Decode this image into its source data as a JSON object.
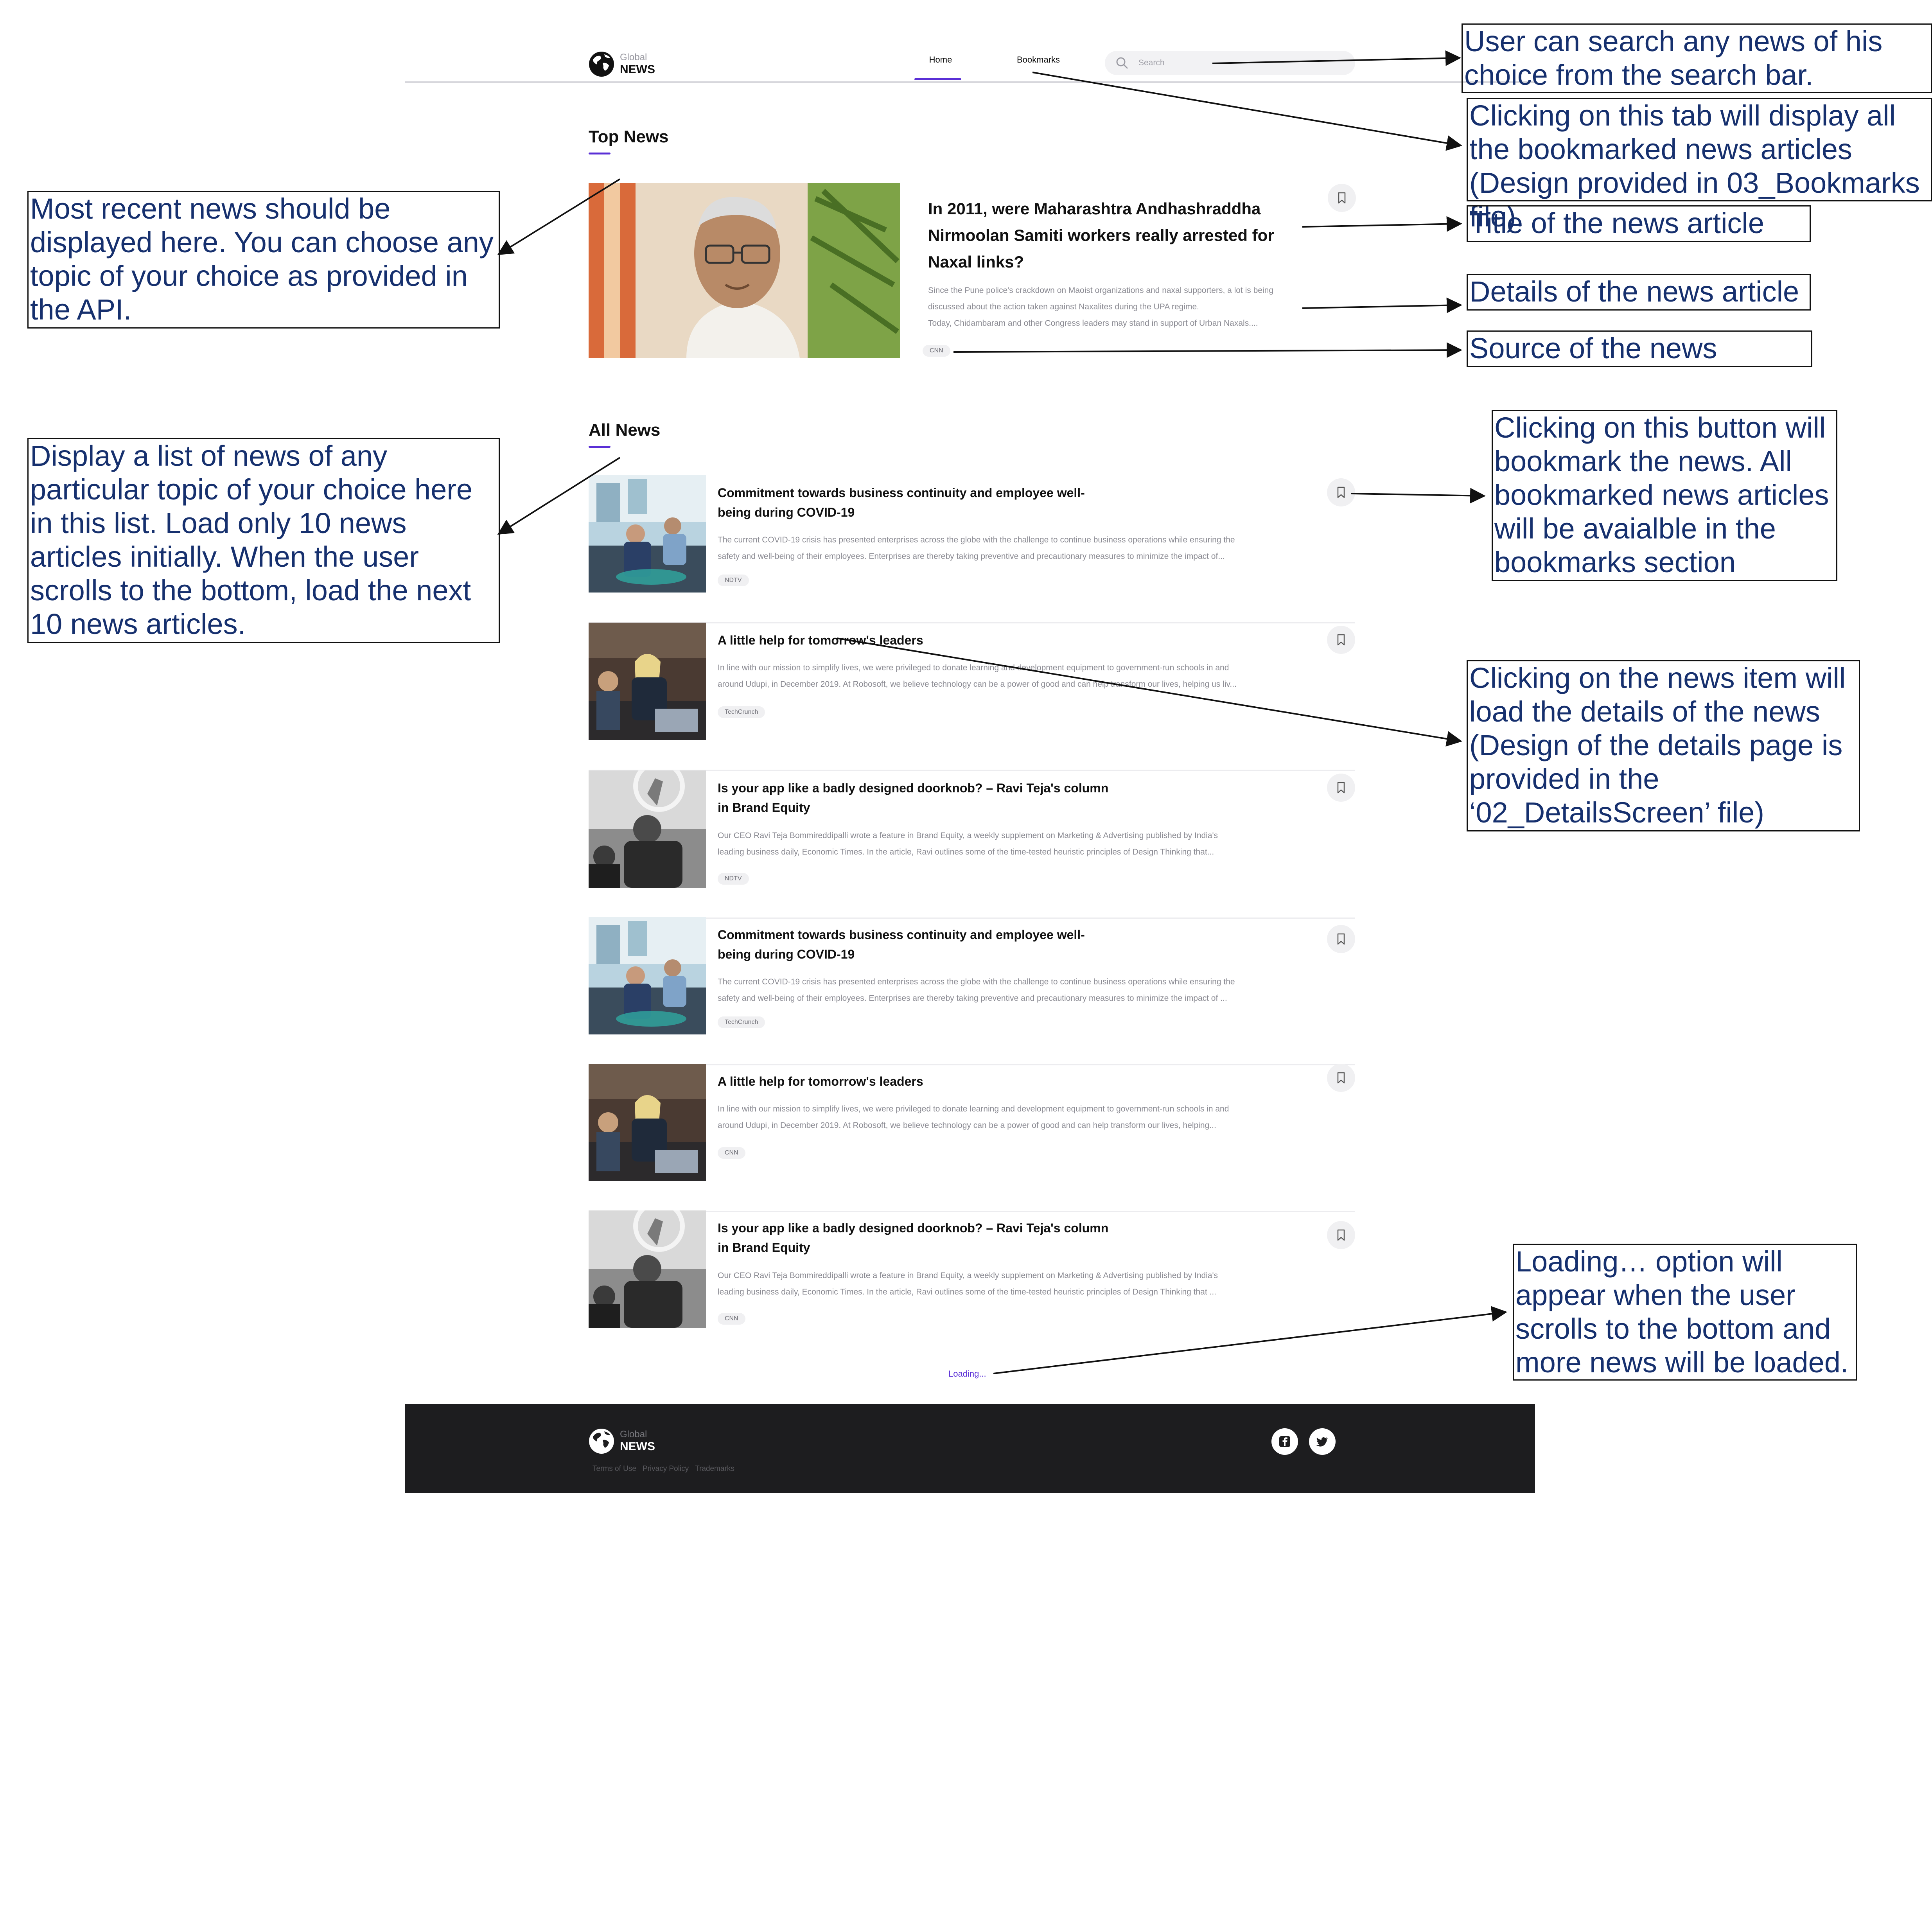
{
  "header": {
    "logo_small": "Global",
    "logo_big": "NEWS",
    "nav_home": "Home",
    "nav_bookmarks": "Bookmarks",
    "search_placeholder": "Search",
    "accent": "#5a2fd6"
  },
  "top_news": {
    "heading": "Top News",
    "title": "In 2011, were Maharashtra Andhashraddha Nirmoolan Samiti workers really arrested for Naxal links?",
    "desc_lines": [
      "Since the Pune police's crackdown on Maoist organizations and naxal supporters, a lot is being",
      "discussed about the action taken against Naxalites during the UPA regime.",
      "Today, Chidambaram and other Congress leaders may stand in support of Urban Naxals...."
    ],
    "source": "CNN"
  },
  "all_news": {
    "heading": "All News",
    "items": [
      {
        "title": "Commitment towards business continuity and employee well-being during COVID-19",
        "desc_lines": [
          "The current COVID-19 crisis has presented enterprises across the globe with the challenge to continue business operations while ensuring the",
          "safety and well-being of their employees. Enterprises are thereby taking preventive and precautionary measures to minimize the impact of..."
        ],
        "source": "NDTV"
      },
      {
        "title": "A little help for tomorrow's leaders",
        "desc_lines": [
          "In line with our mission to simplify lives, we were privileged to donate learning and development equipment to government-run schools in and",
          "around Udupi, in December 2019. At Robosoft, we believe technology can be a power of good and can help transform our lives, helping us liv..."
        ],
        "source": "TechCrunch"
      },
      {
        "title": "Is your app like a badly designed doorknob? – Ravi Teja's column in Brand Equity",
        "desc_lines": [
          "Our CEO Ravi Teja Bommireddipalli wrote a feature in Brand Equity, a weekly supplement on Marketing & Advertising published by India's",
          "leading business daily, Economic Times. In the article, Ravi outlines some of the time-tested heuristic principles of Design Thinking that..."
        ],
        "source": "NDTV"
      },
      {
        "title": "Commitment towards business continuity and employee well-being during COVID-19",
        "desc_lines": [
          "The current COVID-19 crisis has presented enterprises across the globe with the challenge to continue business operations while ensuring the",
          "safety and well-being of their employees. Enterprises are thereby taking preventive and precautionary measures to minimize the impact of ..."
        ],
        "source": "TechCrunch"
      },
      {
        "title": "A little help for tomorrow's leaders",
        "desc_lines": [
          "In line with our mission to simplify lives, we were privileged to donate learning and development equipment to government-run schools in and",
          "around Udupi, in December 2019. At Robosoft, we believe technology can be a power of good and can help transform our lives, helping..."
        ],
        "source": "CNN"
      },
      {
        "title": "Is your app like a badly designed doorknob? – Ravi Teja's column in Brand Equity",
        "desc_lines": [
          "Our CEO Ravi Teja Bommireddipalli wrote a feature in Brand Equity, a weekly supplement on Marketing & Advertising published by India's",
          "leading business daily, Economic Times. In the article, Ravi outlines some of the time-tested heuristic principles of Design Thinking that ..."
        ],
        "source": "CNN"
      }
    ],
    "loading_text": "Loading..."
  },
  "footer": {
    "logo_small": "Global",
    "logo_big": "NEWS",
    "links": [
      "Terms of Use",
      "Privacy Policy",
      "Trademarks"
    ],
    "social_icons": [
      "facebook-icon",
      "twitter-icon"
    ]
  },
  "annotations": {
    "search": "User can search any news of his choice from the search bar.",
    "bookmarks_tab": "Clicking on this tab will display all the bookmarked news articles (Design provided in 03_Bookmarks file).",
    "title": "Title of the news article",
    "details": "Details of the news article",
    "source": "Source of the news",
    "top_news": "Most recent news should be displayed here. You can choose any topic of your choice as provided in the API.",
    "all_news": "Display a list of news of any particular topic of your choice here in this list. Load only 10 news articles initially. When the user scrolls to the bottom, load the next 10 news articles.",
    "bookmark_button": "Clicking on this button will bookmark the news. All bookmarked news articles will be avaialble in the bookmarks section",
    "news_item": "Clicking on the news item will load the details of the news (Design of the details page is provided in the ‘02_DetailsScreen’ file)",
    "loading": "Loading… option will appear when the user scrolls to the bottom and more news will be loaded."
  }
}
